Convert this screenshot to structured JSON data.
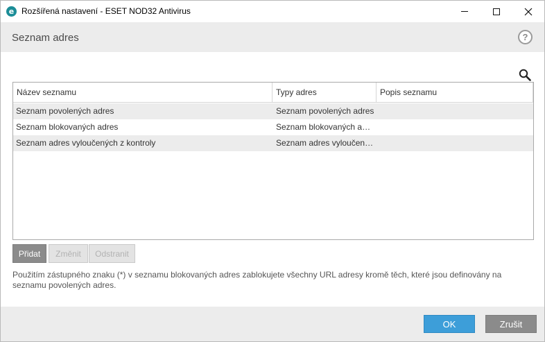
{
  "window": {
    "title": "Rozšířená nastavení - ESET NOD32 Antivirus",
    "app_icon_letter": "e",
    "controls": {
      "minimize": "minimize-icon",
      "maximize": "maximize-icon",
      "close": "close-icon"
    }
  },
  "section": {
    "title": "Seznam adres",
    "help_label": "?"
  },
  "table": {
    "columns": [
      "Název seznamu",
      "Typy adres",
      "Popis seznamu"
    ],
    "rows": [
      {
        "name": "Seznam povolených adres",
        "type": "Seznam povolených adres",
        "description": ""
      },
      {
        "name": "Seznam blokovaných adres",
        "type": "Seznam blokovaných adres",
        "description": ""
      },
      {
        "name": "Seznam adres vyloučených z kontroly",
        "type": "Seznam adres vyloučených z kontroly",
        "description": ""
      }
    ]
  },
  "actions": {
    "add_label": "Přidat",
    "edit_label": "Změnit",
    "remove_label": "Odstranit"
  },
  "note": "Použitím zástupného znaku (*) v seznamu blokovaných adres zablokujete všechny URL adresy kromě těch, které jsou definovány na seznamu povolených adres.",
  "footer": {
    "ok_label": "OK",
    "cancel_label": "Zrušit"
  },
  "colors": {
    "accent": "#3d9ed9",
    "icon_brand": "#1c8d97",
    "button_gray": "#8b8b8b",
    "header_bg": "#ececec"
  }
}
